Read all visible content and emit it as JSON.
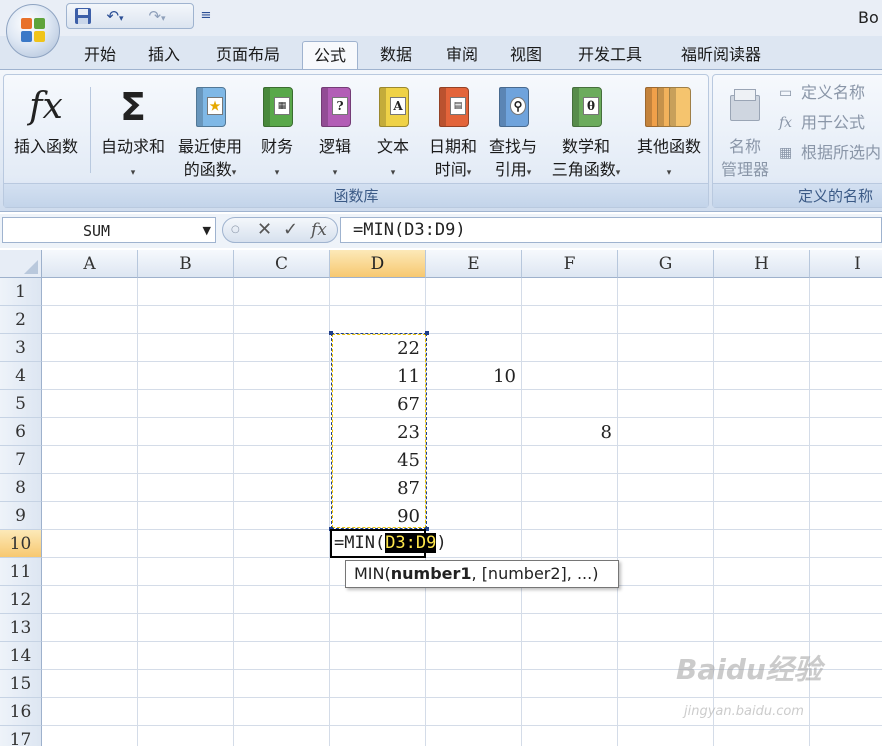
{
  "window": {
    "title": "Bo"
  },
  "quick_access": {
    "save_icon": "save-icon",
    "undo_icon": "undo-icon",
    "redo_icon": "redo-icon",
    "customize_icon": "customize-icon"
  },
  "tabs": [
    {
      "label": "开始"
    },
    {
      "label": "插入"
    },
    {
      "label": "页面布局"
    },
    {
      "label": "公式",
      "active": true
    },
    {
      "label": "数据"
    },
    {
      "label": "审阅"
    },
    {
      "label": "视图"
    },
    {
      "label": "开发工具"
    },
    {
      "label": "福昕阅读器"
    }
  ],
  "ribbon": {
    "function_library": {
      "label": "函数库",
      "insert_function": "插入函数",
      "autosum": "自动求和",
      "recent_line1": "最近使用",
      "recent_line2": "的函数",
      "financial": "财务",
      "logical": "逻辑",
      "text": "文本",
      "datetime_line1": "日期和",
      "datetime_line2": "时间",
      "lookup_line1": "查找与",
      "lookup_line2": "引用",
      "math_line1": "数学和",
      "math_line2": "三角函数",
      "more": "其他函数"
    },
    "defined_names": {
      "label": "定义的名称",
      "name_manager_line1": "名称",
      "name_manager_line2": "管理器",
      "define_name": "定义名称",
      "use_in_formula": "用于公式",
      "create_from_selection": "根据所选内"
    }
  },
  "formula_bar": {
    "name_box": "SUM",
    "cancel_icon": "cancel-icon",
    "enter_icon": "enter-icon",
    "fx_icon": "fx-icon",
    "formula": "=MIN(D3:D9)"
  },
  "sheet": {
    "columns": [
      "A",
      "B",
      "C",
      "D",
      "E",
      "F",
      "G",
      "H",
      "I"
    ],
    "rows": [
      "1",
      "2",
      "3",
      "4",
      "5",
      "6",
      "7",
      "8",
      "9",
      "10",
      "11",
      "12",
      "13",
      "14",
      "15",
      "16",
      "17"
    ],
    "selected_column": "D",
    "selected_row": "10",
    "cells": [
      {
        "ref": "D3",
        "value": "22"
      },
      {
        "ref": "D4",
        "value": "11"
      },
      {
        "ref": "E4",
        "value": "10"
      },
      {
        "ref": "D5",
        "value": "67"
      },
      {
        "ref": "D6",
        "value": "23"
      },
      {
        "ref": "F6",
        "value": "8"
      },
      {
        "ref": "D7",
        "value": "45"
      },
      {
        "ref": "D8",
        "value": "87"
      },
      {
        "ref": "D9",
        "value": "90"
      }
    ],
    "editing": {
      "cell": "D10",
      "prefix": "=MIN(",
      "range": "D3:D9",
      "suffix": ")"
    },
    "tooltip": {
      "func": "MIN(",
      "arg1": "number1",
      "rest": ", [number2], ...)"
    }
  },
  "watermark": {
    "logo": "Baidu经验",
    "url": "jingyan.baidu.com"
  }
}
